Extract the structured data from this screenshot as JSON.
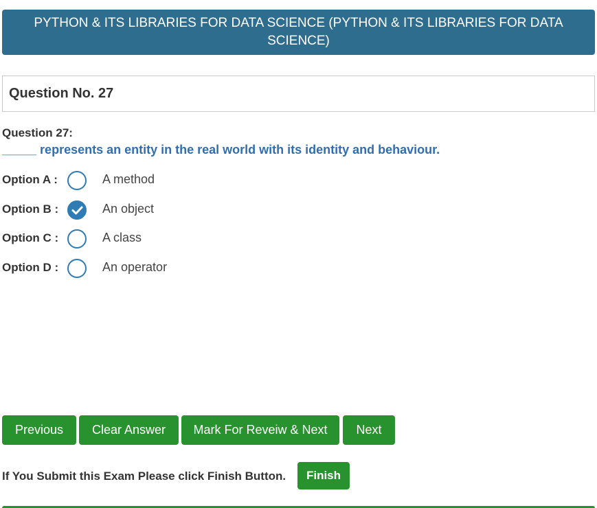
{
  "banner": {
    "title": "PYTHON & ITS LIBRARIES FOR DATA SCIENCE (PYTHON & ITS LIBRARIES FOR DATA SCIENCE)"
  },
  "question": {
    "number_label": "Question No. 27",
    "heading": "Question 27:",
    "text": "_____ represents an entity in the real world with its identity and behaviour."
  },
  "options": [
    {
      "label": "Option A :",
      "text": "A method",
      "selected": false
    },
    {
      "label": "Option B :",
      "text": "An object",
      "selected": true
    },
    {
      "label": "Option C :",
      "text": "A class",
      "selected": false
    },
    {
      "label": "Option D :",
      "text": "An operator",
      "selected": false
    }
  ],
  "actions": {
    "previous": "Previous",
    "clear": "Clear Answer",
    "mark_review": "Mark For Reveiw & Next",
    "next": "Next"
  },
  "submit": {
    "note": "If You Submit this Exam Please click Finish Button.",
    "finish": "Finish"
  },
  "colors": {
    "banner": "#2f6d8f",
    "question_text": "#2f6fb0",
    "button": "#28922e",
    "radio": "#2f7bb3"
  }
}
